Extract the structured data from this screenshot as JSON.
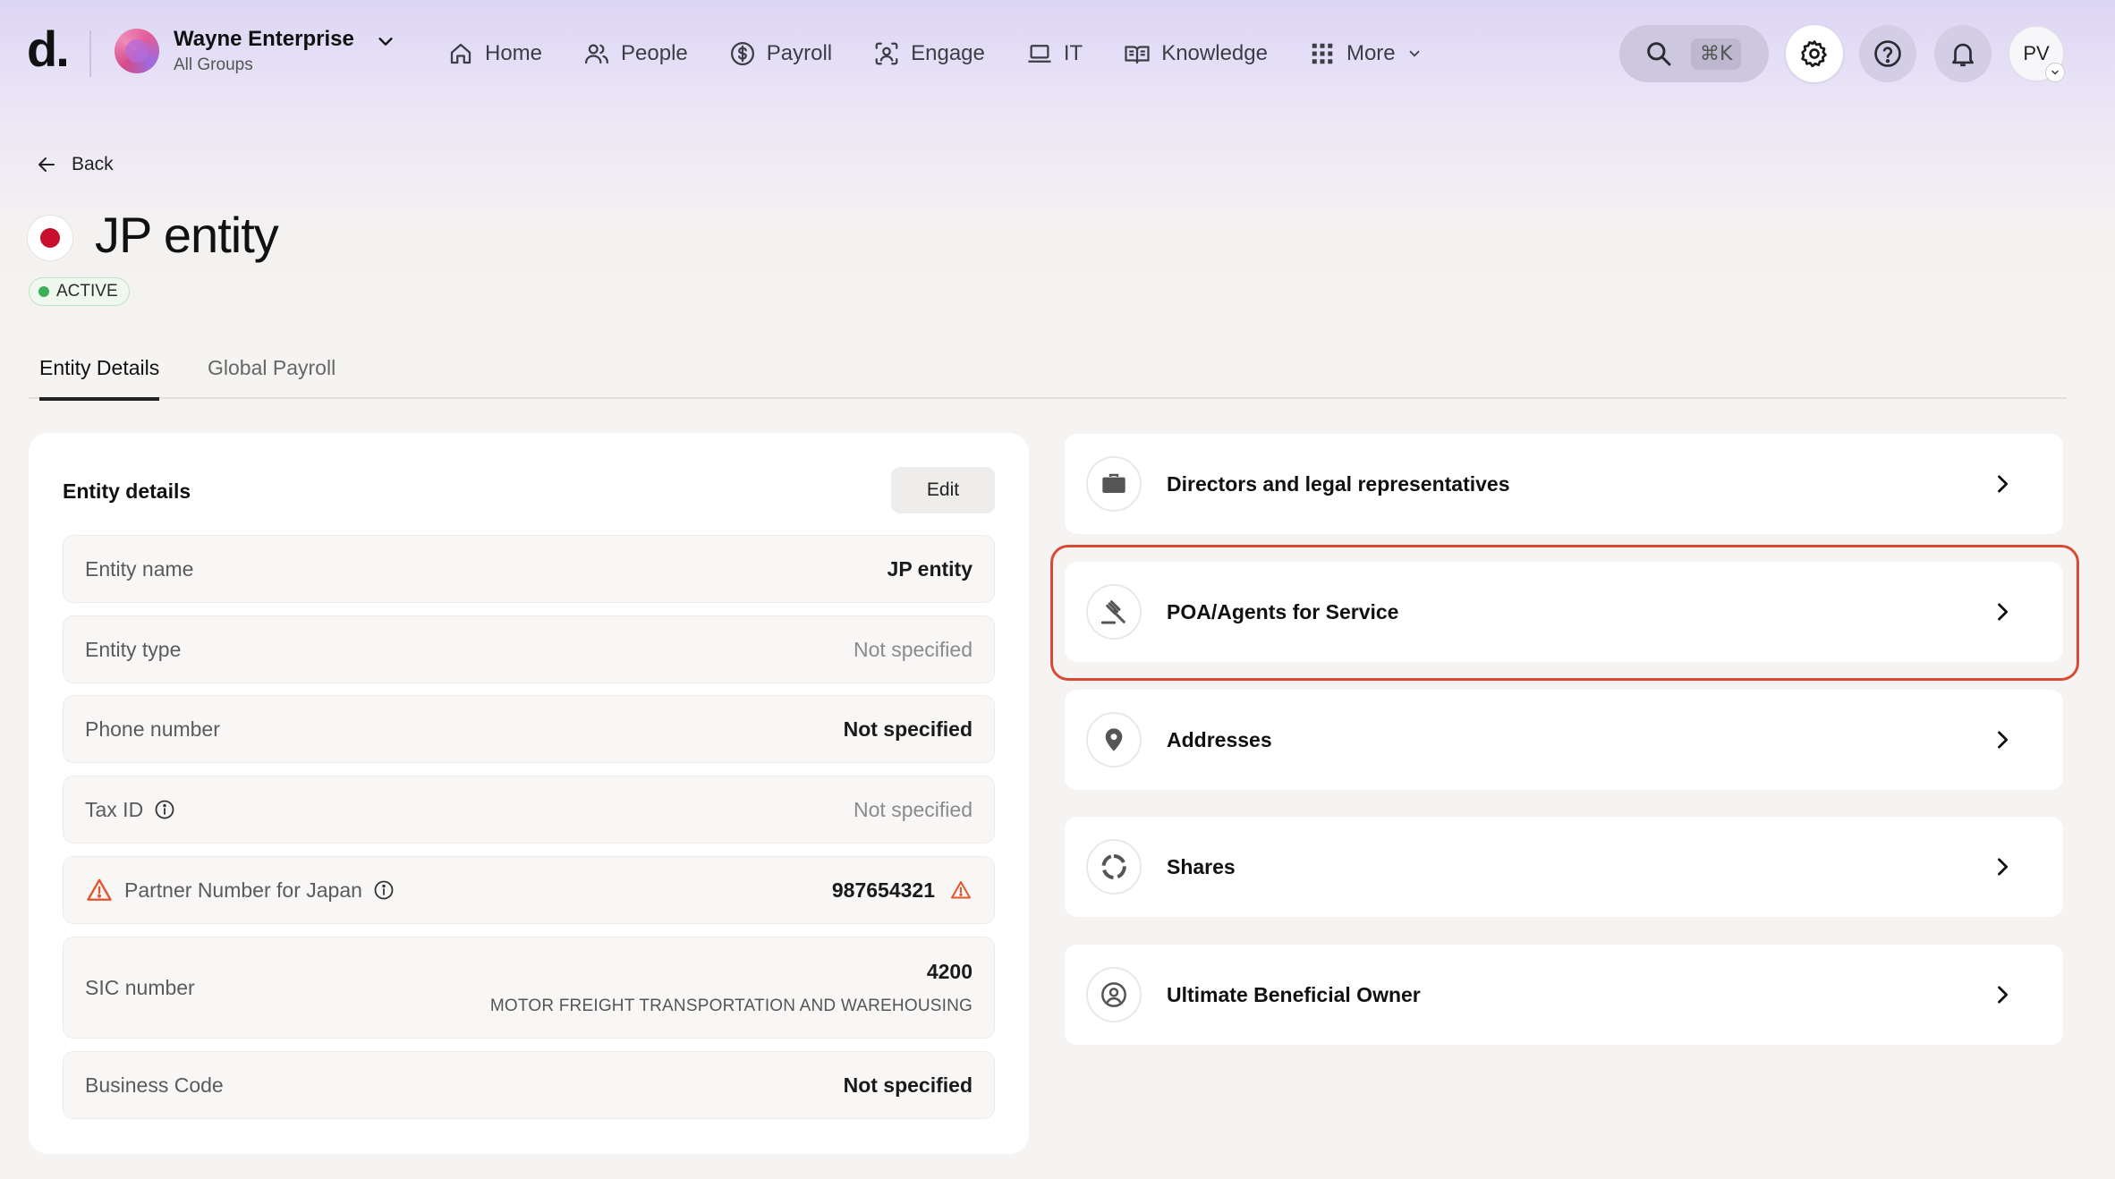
{
  "brand": {
    "logo": "d."
  },
  "org": {
    "name": "Wayne Enterprise",
    "subtitle": "All Groups"
  },
  "nav": {
    "home": "Home",
    "people": "People",
    "payroll": "Payroll",
    "engage": "Engage",
    "it": "IT",
    "knowledge": "Knowledge",
    "more": "More"
  },
  "search": {
    "shortcut": "⌘K"
  },
  "user": {
    "initials": "PV"
  },
  "header": {
    "back_label": "Back",
    "title": "JP entity",
    "status": "ACTIVE"
  },
  "tabs": [
    {
      "label": "Entity Details",
      "active": true
    },
    {
      "label": "Global Payroll",
      "active": false
    }
  ],
  "details": {
    "title": "Entity details",
    "edit_label": "Edit",
    "rows": [
      {
        "label": "Entity name",
        "value": "JP entity"
      },
      {
        "label": "Entity type",
        "value": "Not specified"
      },
      {
        "label": "Phone number",
        "value": "Not specified"
      },
      {
        "label": "Tax ID",
        "value": "Not specified"
      },
      {
        "label": "Partner Number for Japan",
        "value": "987654321"
      },
      {
        "label": "SIC number",
        "value": "4200",
        "sub": "MOTOR FREIGHT TRANSPORTATION AND WAREHOUSING"
      },
      {
        "label": "Business Code",
        "value": "Not specified"
      }
    ]
  },
  "sections": [
    {
      "label": "Directors and legal representatives",
      "icon": "briefcase-icon"
    },
    {
      "label": "POA/Agents for Service",
      "icon": "gavel-icon"
    },
    {
      "label": "Addresses",
      "icon": "location-pin-icon"
    },
    {
      "label": "Shares",
      "icon": "pie-ring-icon"
    },
    {
      "label": "Ultimate Beneficial Owner",
      "icon": "user-circle-icon"
    }
  ],
  "colors": {
    "highlight": "#d94a36",
    "active_status": "#3fae5a",
    "flag_red": "#c8102e",
    "warning": "#e4572e"
  }
}
